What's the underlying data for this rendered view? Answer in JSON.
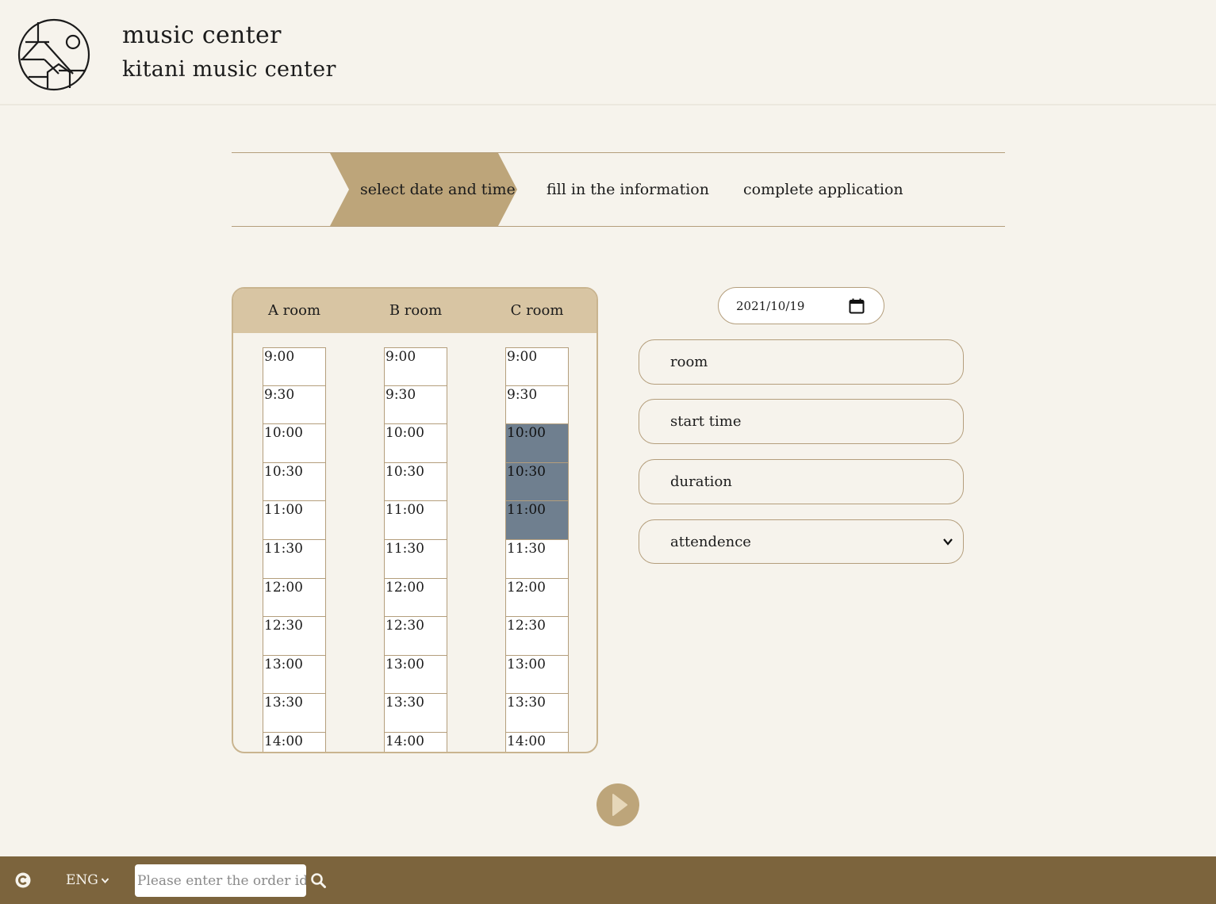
{
  "header": {
    "title": "music center",
    "subtitle": "kitani music center",
    "logo_icon": "mountain-house-logo"
  },
  "steps": [
    {
      "label": "select date and time",
      "active": true
    },
    {
      "label": "fill in the information",
      "active": false
    },
    {
      "label": "complete application",
      "active": false
    }
  ],
  "schedule": {
    "rooms": [
      "A room",
      "B room",
      "C room"
    ],
    "times": [
      "9:00",
      "9:30",
      "10:00",
      "10:30",
      "11:00",
      "11:30",
      "12:00",
      "12:30",
      "13:00",
      "13:30",
      "14:00"
    ],
    "booked": {
      "C room": [
        "10:00",
        "10:30",
        "11:00"
      ]
    },
    "booked_color": "#6f7f8f"
  },
  "form": {
    "date_value": "2021/10/19",
    "room_placeholder": "room",
    "start_time_placeholder": "start time",
    "duration_placeholder": "duration",
    "attendence_selected": "attendence"
  },
  "footer": {
    "language": "ENG",
    "order_placeholder": "Please enter the order id"
  },
  "colors": {
    "background": "#f6f3ec",
    "accent": "#bda57a",
    "table_header": "#d8c5a3",
    "footer": "#7c643d",
    "border": "#b49e7c"
  }
}
